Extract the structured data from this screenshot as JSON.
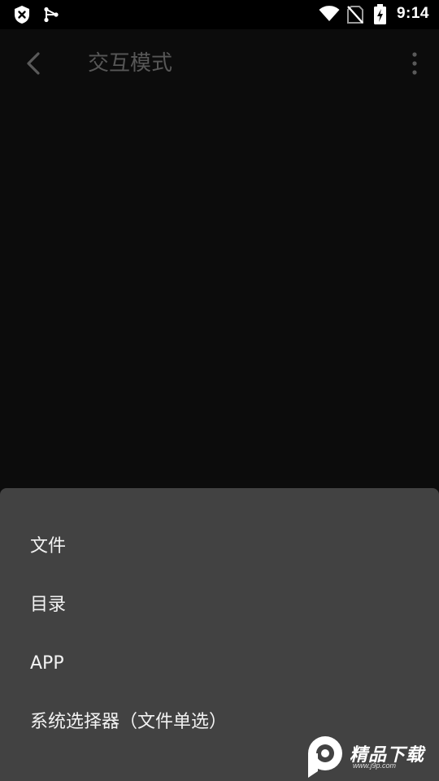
{
  "status_bar": {
    "time": "9:14",
    "left_icons": [
      "shield-x-icon",
      "share-node-icon"
    ],
    "right_icons": [
      "wifi-icon",
      "no-sim-icon",
      "battery-charging-icon"
    ]
  },
  "app_bar": {
    "title": "交互模式",
    "back_icon": "chevron-left-icon",
    "menu_icon": "more-vert-icon"
  },
  "bottom_sheet": {
    "items": [
      {
        "label": "文件"
      },
      {
        "label": "目录"
      },
      {
        "label": "APP"
      },
      {
        "label": "系统选择器（文件单选）"
      }
    ]
  },
  "watermark": {
    "text": "精品下载",
    "url": "www.j9p.com"
  },
  "colors": {
    "background": "#0c0c0c",
    "sheet": "#424242",
    "title": "#575757",
    "status_bar": "#000000"
  }
}
